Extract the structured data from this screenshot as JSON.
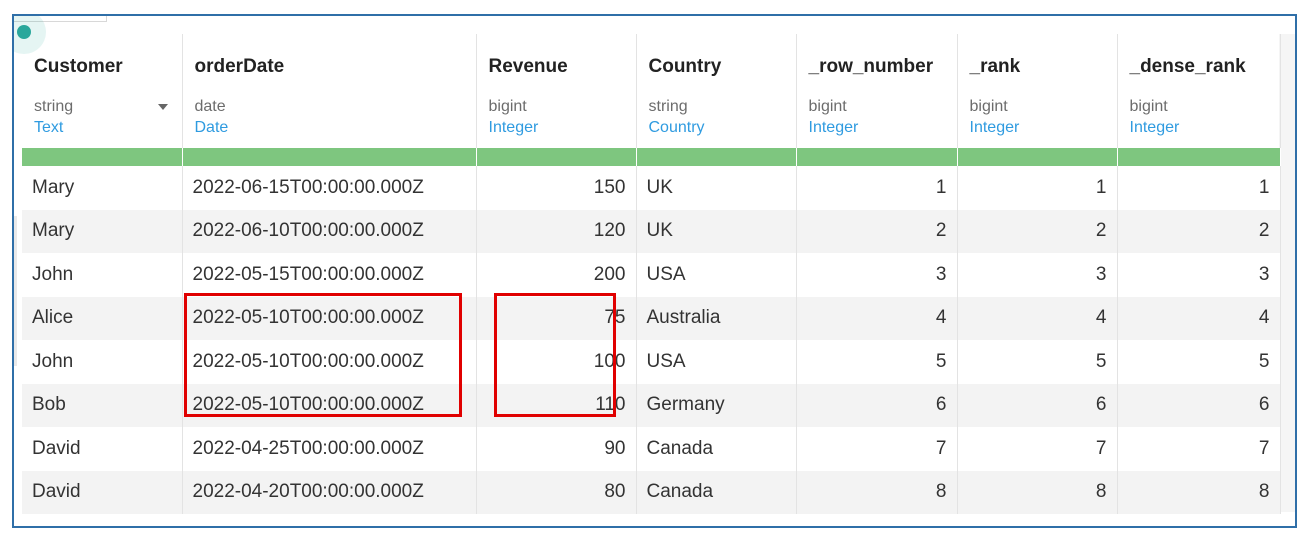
{
  "table": {
    "columns": [
      {
        "name": "Customer",
        "type": "string",
        "semantic": "Text",
        "numeric": false
      },
      {
        "name": "orderDate",
        "type": "date",
        "semantic": "Date",
        "numeric": false
      },
      {
        "name": "Revenue",
        "type": "bigint",
        "semantic": "Integer",
        "numeric": true
      },
      {
        "name": "Country",
        "type": "string",
        "semantic": "Country",
        "numeric": false
      },
      {
        "name": "_row_number",
        "type": "bigint",
        "semantic": "Integer",
        "numeric": true
      },
      {
        "name": "_rank",
        "type": "bigint",
        "semantic": "Integer",
        "numeric": true
      },
      {
        "name": "_dense_rank",
        "type": "bigint",
        "semantic": "Integer",
        "numeric": true
      }
    ],
    "rows": [
      [
        "Mary",
        "2022-06-15T00:00:00.000Z",
        "150",
        "UK",
        "1",
        "1",
        "1"
      ],
      [
        "Mary",
        "2022-06-10T00:00:00.000Z",
        "120",
        "UK",
        "2",
        "2",
        "2"
      ],
      [
        "John",
        "2022-05-15T00:00:00.000Z",
        "200",
        "USA",
        "3",
        "3",
        "3"
      ],
      [
        "Alice",
        "2022-05-10T00:00:00.000Z",
        "75",
        "Australia",
        "4",
        "4",
        "4"
      ],
      [
        "John",
        "2022-05-10T00:00:00.000Z",
        "100",
        "USA",
        "5",
        "5",
        "5"
      ],
      [
        "Bob",
        "2022-05-10T00:00:00.000Z",
        "110",
        "Germany",
        "6",
        "6",
        "6"
      ],
      [
        "David",
        "2022-04-25T00:00:00.000Z",
        "90",
        "Canada",
        "7",
        "7",
        "7"
      ],
      [
        "David",
        "2022-04-20T00:00:00.000Z",
        "80",
        "Canada",
        "8",
        "8",
        "8"
      ]
    ]
  },
  "colors": {
    "frame_border": "#2f6fa8",
    "quality_bar": "#7ec67f",
    "semantic_type_text": "#2f9be0",
    "highlight": "#e00000",
    "status_dot": "#2aa79b"
  },
  "icons": {
    "type_dropdown": "chevron-down-icon",
    "status": "status-dot-icon"
  }
}
